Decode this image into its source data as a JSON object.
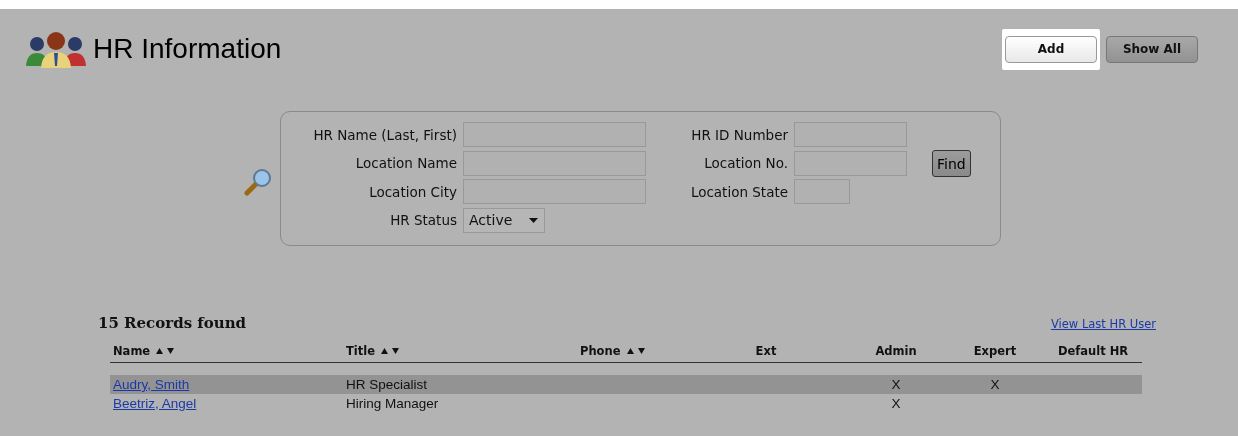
{
  "header": {
    "title": "HR Information"
  },
  "buttons": [
    {
      "label": "Add",
      "highlighted": true
    },
    {
      "label": "Show All",
      "highlighted": false
    }
  ],
  "search": {
    "left_fields": [
      {
        "label": "HR Name (Last, First)",
        "kind": "text"
      },
      {
        "label": "Location Name",
        "kind": "text"
      },
      {
        "label": "Location City",
        "kind": "text"
      },
      {
        "label": "HR Status",
        "kind": "select",
        "value": "Active"
      }
    ],
    "right_fields": [
      {
        "label": "HR ID Number",
        "kind": "text"
      },
      {
        "label": "Location No.",
        "kind": "text"
      },
      {
        "label": "Location State",
        "kind": "short"
      }
    ],
    "find_button": "Find"
  },
  "results": {
    "count": "15 Records found",
    "link": "View Last HR User",
    "columns": [
      {
        "label": "Name",
        "sortable": true
      },
      {
        "label": "Title",
        "sortable": true
      },
      {
        "label": "Phone",
        "sortable": true
      },
      {
        "label": "Ext",
        "sortable": false
      },
      {
        "label": "Admin",
        "sortable": false
      },
      {
        "label": "Expert",
        "sortable": false
      },
      {
        "label": "Default HR",
        "sortable": false
      }
    ],
    "rows": [
      {
        "name": "Audry, Smith",
        "title": "HR Specialist",
        "admin": "X",
        "expert": "X",
        "selected": true
      },
      {
        "name": "Beetriz, Angel",
        "title": "Hiring Manager",
        "admin": "X",
        "selected": false
      }
    ]
  }
}
